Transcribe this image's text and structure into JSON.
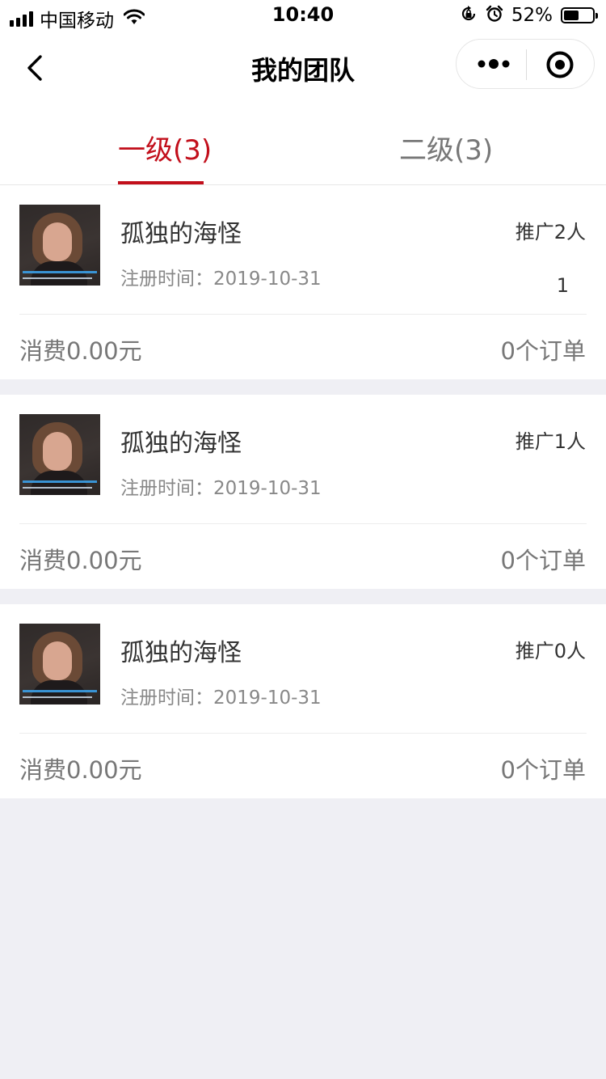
{
  "status_bar": {
    "carrier": "中国移动",
    "time": "10:40",
    "battery_percent": "52%",
    "battery_level": 0.52,
    "icons": [
      "signal-icon",
      "wifi-icon",
      "orientation-lock-icon",
      "alarm-icon",
      "battery-icon"
    ]
  },
  "nav": {
    "title": "我的团队",
    "icons": [
      "back-icon",
      "more-icon",
      "target-icon"
    ]
  },
  "tabs": [
    {
      "label": "一级(3)",
      "active": true
    },
    {
      "label": "二级(3)",
      "active": false
    }
  ],
  "members": [
    {
      "name": "孤独的海怪",
      "reg_label": "注册时间：",
      "reg_date": "2019-10-31",
      "promo": "推广2人",
      "extra": "1",
      "spend": "消费0.00元",
      "orders": "0个订单"
    },
    {
      "name": "孤独的海怪",
      "reg_label": "注册时间：",
      "reg_date": "2019-10-31",
      "promo": "推广1人",
      "spend": "消费0.00元",
      "orders": "0个订单"
    },
    {
      "name": "孤独的海怪",
      "reg_label": "注册时间：",
      "reg_date": "2019-10-31",
      "promo": "推广0人",
      "spend": "消费0.00元",
      "orders": "0个订单"
    }
  ],
  "colors": {
    "accent": "#c20f1b",
    "background": "#efeff4"
  }
}
